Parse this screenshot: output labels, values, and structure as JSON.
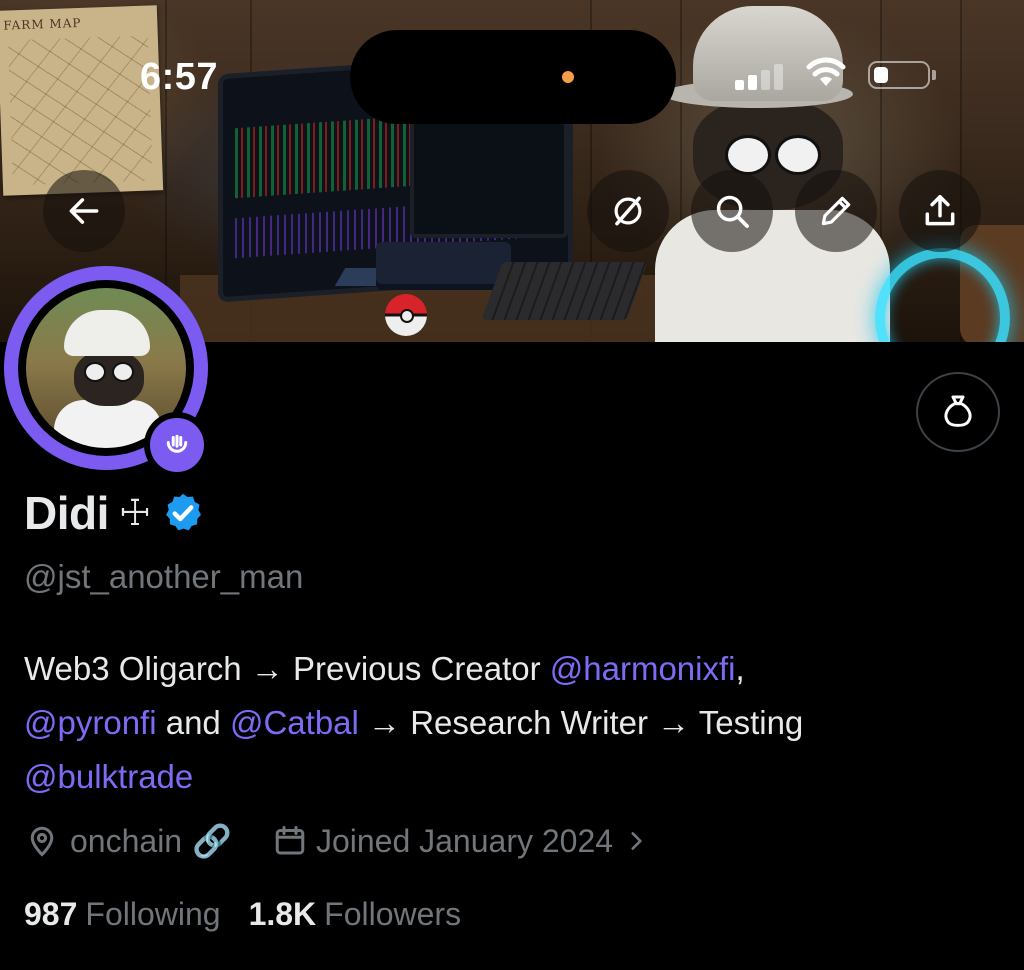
{
  "status_bar": {
    "time": "6:57"
  },
  "banner": {
    "map_title": "FARM MAP"
  },
  "nav": {
    "back_icon": "arrow-left-icon",
    "grok_icon": "grok-icon",
    "search_icon": "search-icon",
    "edit_icon": "pencil-icon",
    "share_icon": "share-icon"
  },
  "profile": {
    "name": "Didi",
    "name_suffix": "☩",
    "verified": true,
    "handle": "@jst_another_man",
    "bio": {
      "line1_prefix": "Web3 Oligarch → Previous Creator ",
      "mention1": "@harmonixfi",
      "line1_suffix": ",",
      "mention2": "@pyronfi",
      "mid": " and ",
      "mention3": "@Catbal",
      "line2_suffix": " → Research Writer → Testing",
      "mention4": "@bulktrade"
    },
    "location": "onchain",
    "joined": "Joined January 2024",
    "following_count": "987",
    "following_label": "Following",
    "followers_count": "1.8K",
    "followers_label": "Followers"
  },
  "colors": {
    "accent": "#7c5cf0",
    "mention": "#7c6cf5",
    "verified": "#1d9bf0",
    "muted": "#71767b"
  }
}
